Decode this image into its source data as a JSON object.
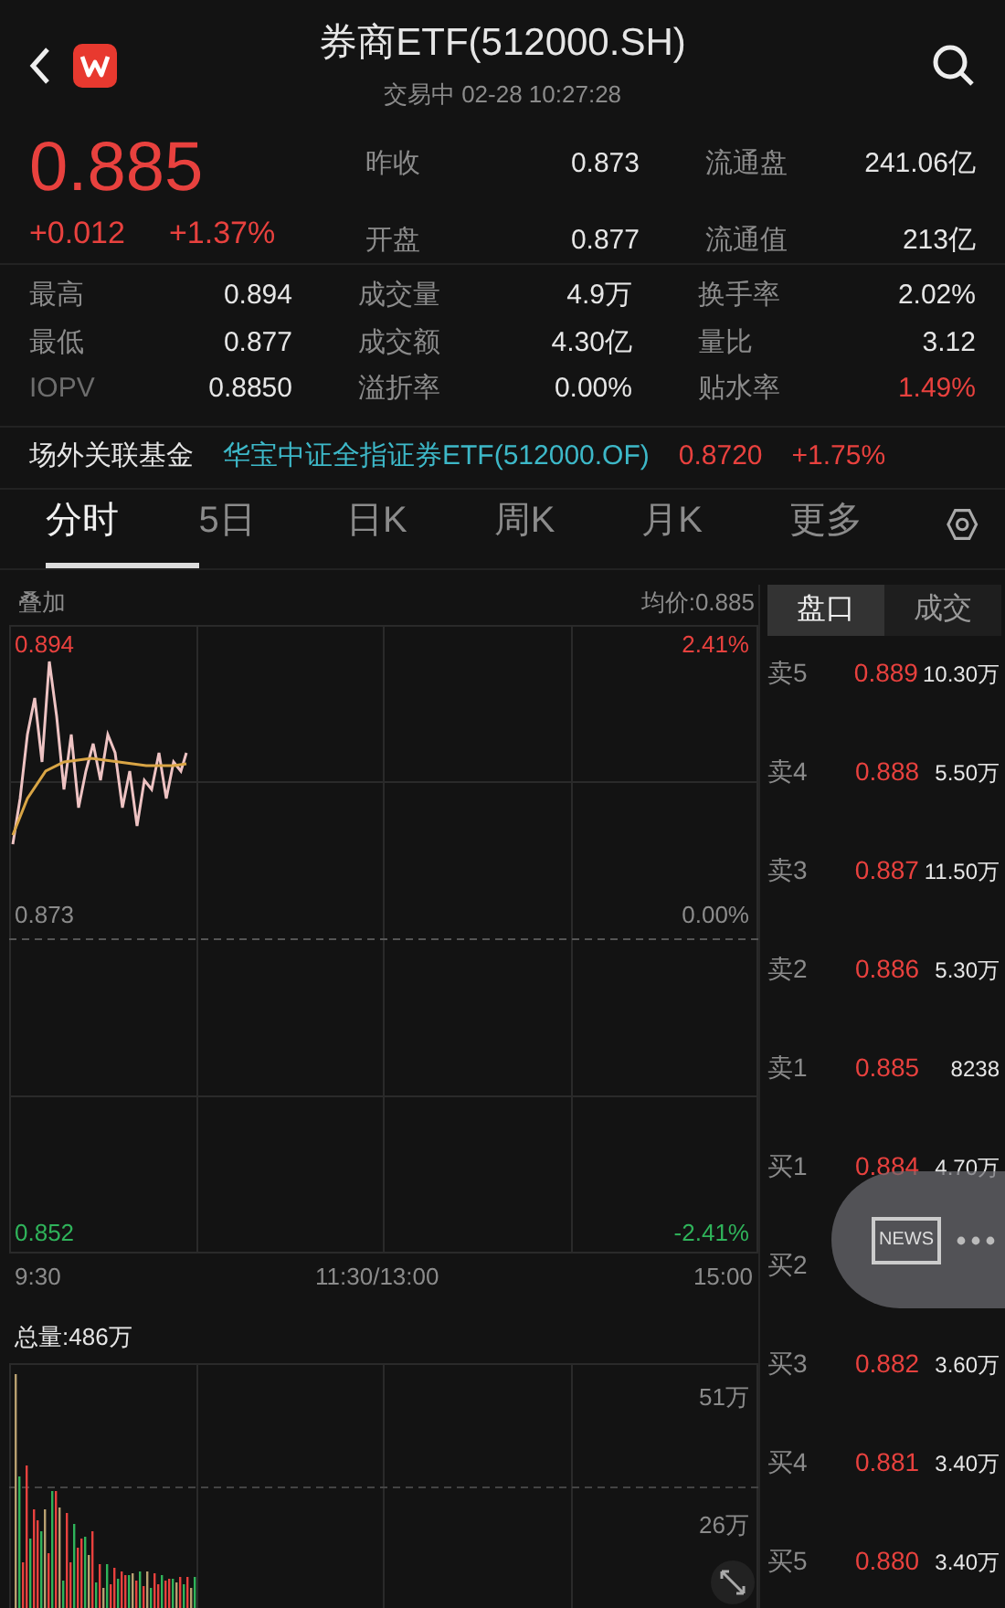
{
  "header": {
    "title": "券商ETF(512000.SH)",
    "status": "交易中 02-28 10:27:28"
  },
  "quote": {
    "price": "0.885",
    "change": "+0.012",
    "change_pct": "+1.37%",
    "side_stats": [
      {
        "label": "昨收",
        "value": "0.873"
      },
      {
        "label": "流通盘",
        "value": "241.06亿"
      },
      {
        "label": "开盘",
        "value": "0.877"
      },
      {
        "label": "流通值",
        "value": "213亿"
      }
    ],
    "stats": [
      {
        "label": "最高",
        "value": "0.894",
        "color": "#e6e6e6"
      },
      {
        "label": "成交量",
        "value": "4.9万",
        "color": "#e6e6e6"
      },
      {
        "label": "换手率",
        "value": "2.02%",
        "color": "#e6e6e6"
      },
      {
        "label": "最低",
        "value": "0.877",
        "color": "#e6e6e6"
      },
      {
        "label": "成交额",
        "value": "4.30亿",
        "color": "#e6e6e6"
      },
      {
        "label": "量比",
        "value": "3.12",
        "color": "#e6e6e6"
      },
      {
        "label": "IOPV",
        "value": "0.8850",
        "color": "#e6e6e6"
      },
      {
        "label": "溢折率",
        "value": "0.00%",
        "color": "#e6e6e6"
      },
      {
        "label": "贴水率",
        "value": "1.49%",
        "color": "#e8413e"
      }
    ]
  },
  "related_fund": {
    "label": "场外关联基金",
    "name": "华宝中证全指证券ETF(512000.OF)",
    "price": "0.8720",
    "change": "+1.75%"
  },
  "tabs": [
    {
      "label": "分时",
      "selected": true
    },
    {
      "label": "5日",
      "selected": false
    },
    {
      "label": "日K",
      "selected": false
    },
    {
      "label": "周K",
      "selected": false
    },
    {
      "label": "月K",
      "selected": false
    },
    {
      "label": "更多",
      "selected": false
    }
  ],
  "price_chart": {
    "overlay": "叠加",
    "average": "均价:0.885",
    "high": "0.894",
    "high_pct": "2.41%",
    "base": "0.873",
    "base_pct": "0.00%",
    "low": "0.852",
    "low_pct": "-2.41%",
    "times": [
      "9:30",
      "11:30/13:00",
      "15:00"
    ]
  },
  "volume_chart": {
    "total": "总量:486万",
    "top_tick": "51万",
    "mid_tick": "26万"
  },
  "order_book": {
    "tabs": [
      {
        "label": "盘口",
        "selected": true
      },
      {
        "label": "成交",
        "selected": false
      }
    ],
    "rows": [
      {
        "label": "卖5",
        "price": "0.889",
        "volume": "10.30万"
      },
      {
        "label": "卖4",
        "price": "0.888",
        "volume": "5.50万"
      },
      {
        "label": "卖3",
        "price": "0.887",
        "volume": "11.50万"
      },
      {
        "label": "卖2",
        "price": "0.886",
        "volume": "5.30万"
      },
      {
        "label": "卖1",
        "price": "0.885",
        "volume": "8238"
      },
      {
        "label": "买1",
        "price": "0.884",
        "volume": "4.70万"
      },
      {
        "label": "买2"
      },
      {
        "label": "买3",
        "price": "0.882",
        "volume": "3.60万"
      },
      {
        "label": "买4",
        "price": "0.881",
        "volume": "3.40万"
      },
      {
        "label": "买5",
        "price": "0.880",
        "volume": "3.40万"
      }
    ]
  },
  "news_button": {
    "label": "NEWS"
  }
}
